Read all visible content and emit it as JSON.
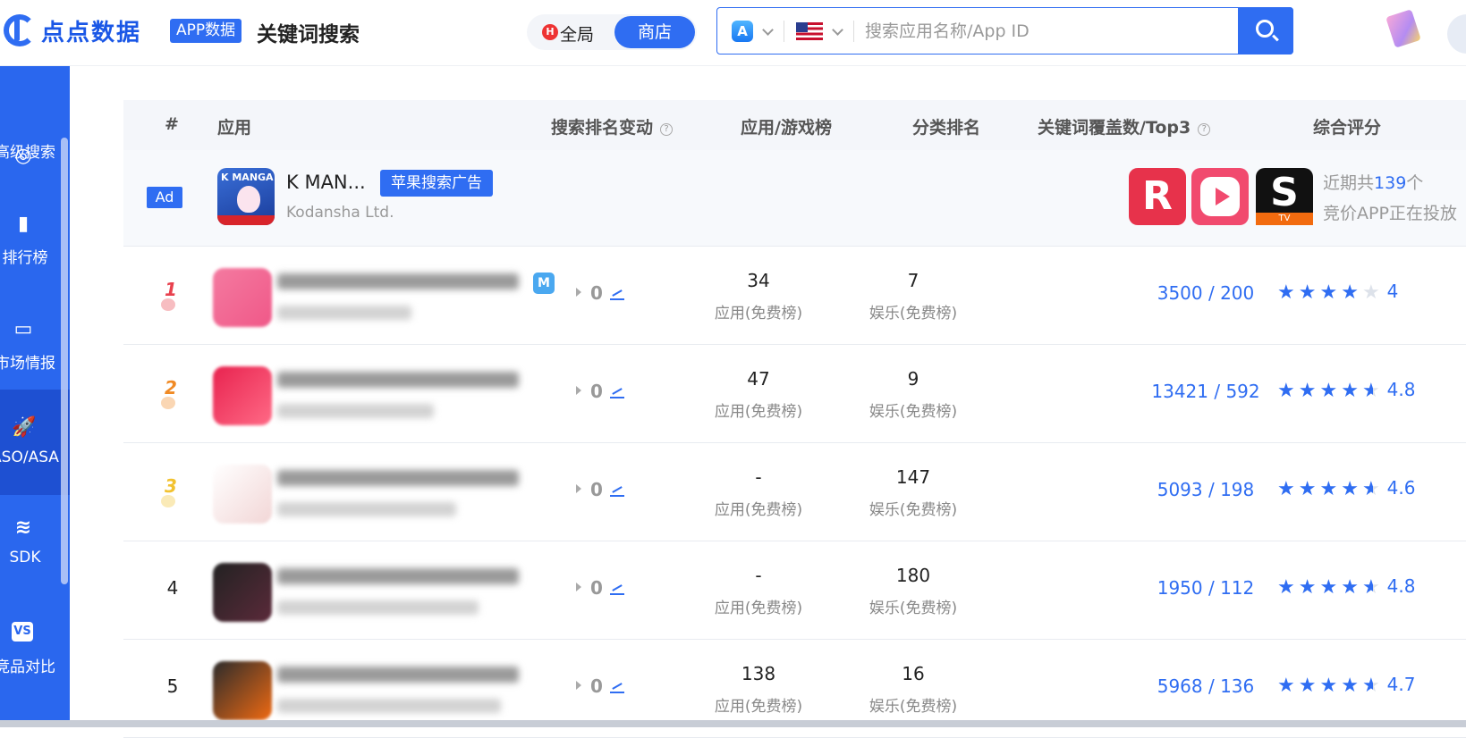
{
  "header": {
    "logo_text": "点点数据",
    "app_badge": "APP数据",
    "page_title": "关键词搜索",
    "scope_all": "全局",
    "scope_store": "商店",
    "search_placeholder": "搜索应用名称/App ID"
  },
  "sidebar": {
    "items": [
      {
        "label": "高级搜索",
        "icon": "search-icon"
      },
      {
        "label": "排行榜",
        "icon": "bar-chart-icon"
      },
      {
        "label": "市场情报",
        "icon": "market-icon"
      },
      {
        "label": "ASO/ASA",
        "icon": "rocket-icon",
        "active": true
      },
      {
        "label": "SDK",
        "icon": "layers-icon"
      },
      {
        "label": "竞品对比",
        "icon": "vs-icon"
      }
    ]
  },
  "table": {
    "headers": {
      "rank": "#",
      "app": "应用",
      "search_change": "搜索排名变动",
      "chart": "应用/游戏榜",
      "category": "分类排名",
      "coverage": "关键词覆盖数/Top3",
      "rating": "综合评分"
    },
    "ad_row": {
      "tag": "Ad",
      "app_name": "K MAN...",
      "badge": "苹果搜索广告",
      "developer": "Kodansha Ltd.",
      "note_prefix": "近期共",
      "note_count": "139",
      "note_suffix": "个",
      "note_line2": "竞价APP正在投放"
    },
    "rows": [
      {
        "rank": "1",
        "change": "0",
        "chart_rank": "34",
        "chart_label": "应用(免费榜)",
        "cat_rank": "7",
        "cat_label": "娱乐(免费榜)",
        "coverage": "3500 / 200",
        "rating": 4,
        "score": "4"
      },
      {
        "rank": "2",
        "change": "0",
        "chart_rank": "47",
        "chart_label": "应用(免费榜)",
        "cat_rank": "9",
        "cat_label": "娱乐(免费榜)",
        "coverage": "13421 / 592",
        "rating": 4.8,
        "score": "4.8"
      },
      {
        "rank": "3",
        "change": "0",
        "chart_rank": "-",
        "chart_label": "应用(免费榜)",
        "cat_rank": "147",
        "cat_label": "娱乐(免费榜)",
        "coverage": "5093 / 198",
        "rating": 4.6,
        "score": "4.6"
      },
      {
        "rank": "4",
        "change": "0",
        "chart_rank": "-",
        "chart_label": "应用(免费榜)",
        "cat_rank": "180",
        "cat_label": "娱乐(免费榜)",
        "coverage": "1950 / 112",
        "rating": 4.8,
        "score": "4.8"
      },
      {
        "rank": "5",
        "change": "0",
        "chart_rank": "138",
        "chart_label": "应用(免费榜)",
        "cat_rank": "16",
        "cat_label": "娱乐(免费榜)",
        "coverage": "5968 / 136",
        "rating": 4.7,
        "score": "4.7"
      }
    ]
  },
  "colors": {
    "accent": "#2f6df2",
    "sidebar": "#2a67ee"
  }
}
